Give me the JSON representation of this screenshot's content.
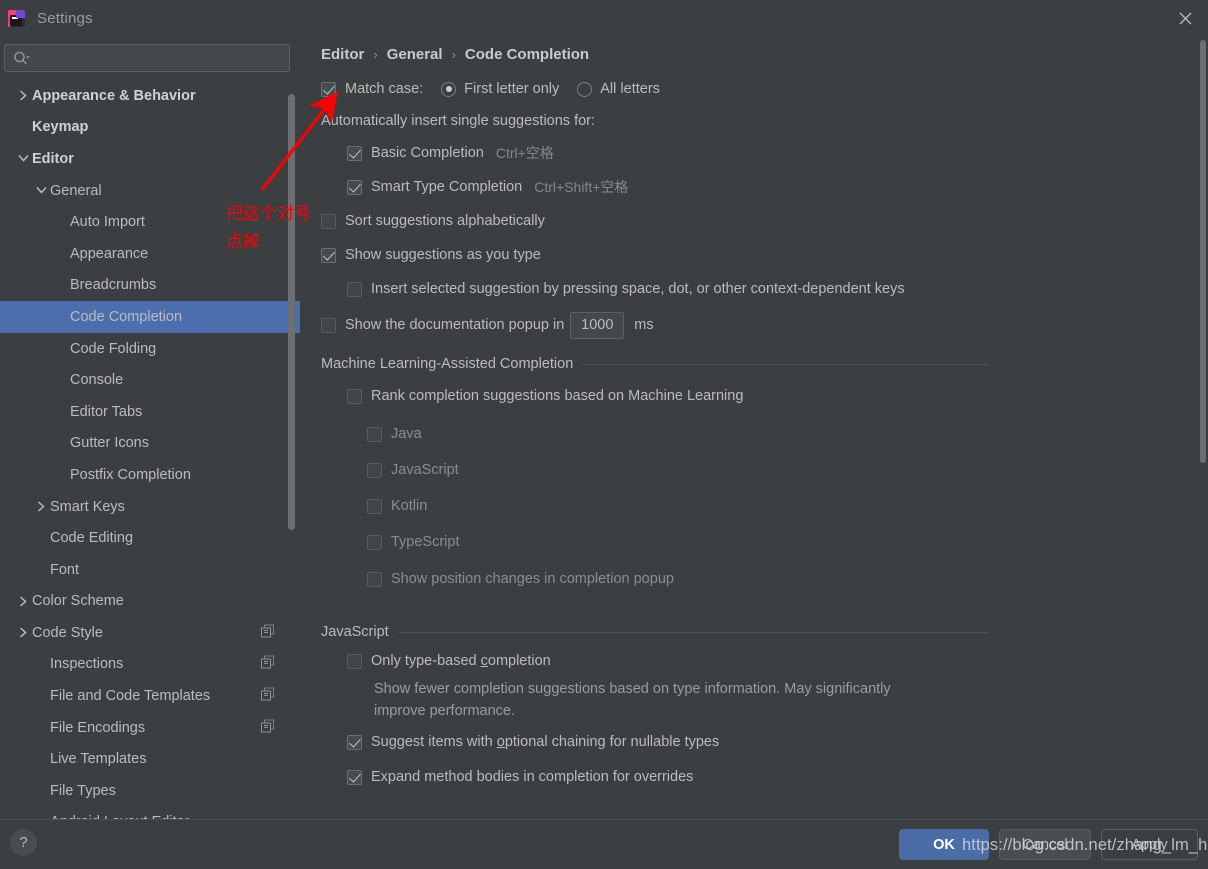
{
  "window": {
    "title": "Settings",
    "app_icon": "intellij-idea-icon",
    "close_label": "×"
  },
  "sidebar": {
    "search": {
      "placeholder": "",
      "value": "",
      "icon": "search-icon"
    },
    "items": [
      {
        "label": "Appearance & Behavior",
        "indent": 0,
        "arrow": "right",
        "bold": true,
        "selected": false,
        "copy": false
      },
      {
        "label": "Keymap",
        "indent": 0,
        "arrow": "none",
        "bold": true,
        "selected": false,
        "copy": false
      },
      {
        "label": "Editor",
        "indent": 0,
        "arrow": "down",
        "bold": true,
        "selected": false,
        "copy": false
      },
      {
        "label": "General",
        "indent": 1,
        "arrow": "down",
        "bold": false,
        "selected": false,
        "copy": false
      },
      {
        "label": "Auto Import",
        "indent": 2,
        "arrow": "none",
        "bold": false,
        "selected": false,
        "copy": false
      },
      {
        "label": "Appearance",
        "indent": 2,
        "arrow": "none",
        "bold": false,
        "selected": false,
        "copy": false
      },
      {
        "label": "Breadcrumbs",
        "indent": 2,
        "arrow": "none",
        "bold": false,
        "selected": false,
        "copy": false
      },
      {
        "label": "Code Completion",
        "indent": 2,
        "arrow": "none",
        "bold": false,
        "selected": true,
        "copy": false
      },
      {
        "label": "Code Folding",
        "indent": 2,
        "arrow": "none",
        "bold": false,
        "selected": false,
        "copy": false
      },
      {
        "label": "Console",
        "indent": 2,
        "arrow": "none",
        "bold": false,
        "selected": false,
        "copy": false
      },
      {
        "label": "Editor Tabs",
        "indent": 2,
        "arrow": "none",
        "bold": false,
        "selected": false,
        "copy": false
      },
      {
        "label": "Gutter Icons",
        "indent": 2,
        "arrow": "none",
        "bold": false,
        "selected": false,
        "copy": false
      },
      {
        "label": "Postfix Completion",
        "indent": 2,
        "arrow": "none",
        "bold": false,
        "selected": false,
        "copy": false
      },
      {
        "label": "Smart Keys",
        "indent": 1,
        "arrow": "right",
        "bold": false,
        "selected": false,
        "copy": false
      },
      {
        "label": "Code Editing",
        "indent": 1,
        "arrow": "none",
        "bold": false,
        "selected": false,
        "copy": false
      },
      {
        "label": "Font",
        "indent": 1,
        "arrow": "none",
        "bold": false,
        "selected": false,
        "copy": false
      },
      {
        "label": "Color Scheme",
        "indent": 0,
        "arrow": "right",
        "bold": false,
        "selected": false,
        "copy": false
      },
      {
        "label": "Code Style",
        "indent": 0,
        "arrow": "right",
        "bold": false,
        "selected": false,
        "copy": true
      },
      {
        "label": "Inspections",
        "indent": 1,
        "arrow": "none",
        "bold": false,
        "selected": false,
        "copy": true
      },
      {
        "label": "File and Code Templates",
        "indent": 1,
        "arrow": "none",
        "bold": false,
        "selected": false,
        "copy": true
      },
      {
        "label": "File Encodings",
        "indent": 1,
        "arrow": "none",
        "bold": false,
        "selected": false,
        "copy": true
      },
      {
        "label": "Live Templates",
        "indent": 1,
        "arrow": "none",
        "bold": false,
        "selected": false,
        "copy": false
      },
      {
        "label": "File Types",
        "indent": 1,
        "arrow": "none",
        "bold": false,
        "selected": false,
        "copy": false
      },
      {
        "label": "Android Layout Editor",
        "indent": 1,
        "arrow": "none",
        "bold": false,
        "selected": false,
        "copy": false
      }
    ]
  },
  "breadcrumb": {
    "items": [
      "Editor",
      "General",
      "Code Completion"
    ],
    "separator": "›"
  },
  "main": {
    "match_case": {
      "label": "Match case:",
      "checked": true,
      "options": [
        {
          "label": "First letter only",
          "selected": true
        },
        {
          "label": "All letters",
          "selected": false
        }
      ]
    },
    "auto_insert_header": "Automatically insert single suggestions for:",
    "auto_insert_items": [
      {
        "label": "Basic Completion",
        "shortcut": "Ctrl+空格",
        "checked": true
      },
      {
        "label": "Smart Type Completion",
        "shortcut": "Ctrl+Shift+空格",
        "checked": true
      }
    ],
    "sort_alphabetically": {
      "label": "Sort suggestions alphabetically",
      "checked": false
    },
    "show_as_you_type": {
      "label": "Show suggestions as you type",
      "checked": true
    },
    "insert_selected": {
      "label": "Insert selected suggestion by pressing space, dot, or other context-dependent keys",
      "checked": false
    },
    "doc_popup": {
      "label_before": "Show the documentation popup in",
      "value": "1000",
      "label_after": "ms",
      "checked": false
    },
    "ml_section": {
      "title": "Machine Learning-Assisted Completion",
      "rank": {
        "label": "Rank completion suggestions based on Machine Learning",
        "checked": false
      },
      "languages": [
        {
          "label": "Java",
          "checked": false
        },
        {
          "label": "JavaScript",
          "checked": false
        },
        {
          "label": "Kotlin",
          "checked": false
        },
        {
          "label": "TypeScript",
          "checked": false
        }
      ],
      "position_changes": {
        "label": "Show position changes in completion popup",
        "checked": false
      }
    },
    "js_section": {
      "title": "JavaScript",
      "only_type_based": {
        "label_pre": "Only type-based ",
        "label_mnemonic": "c",
        "label_post": "ompletion",
        "checked": false,
        "hint": "Show fewer completion suggestions based on type information. May significantly improve performance."
      },
      "optional_chaining": {
        "label_pre": "Suggest items with ",
        "label_mnemonic": "o",
        "label_post": "ptional chaining for nullable types",
        "checked": true
      },
      "expand_method_bodies": {
        "label": "Expand method bodies in completion for overrides",
        "checked": true
      }
    }
  },
  "footer": {
    "help_label": "?",
    "ok_label": "OK",
    "cancel_label": "Cancel",
    "apply_label": "Apply"
  },
  "annotation": {
    "line1": "把这个对号",
    "line2": "点掉",
    "color": "#fb0000",
    "arrow": "red-arrow-pointing-to-match-case-checkbox"
  },
  "watermark": {
    "text": "https://blog.csdn.net/zhang_lm_h"
  }
}
